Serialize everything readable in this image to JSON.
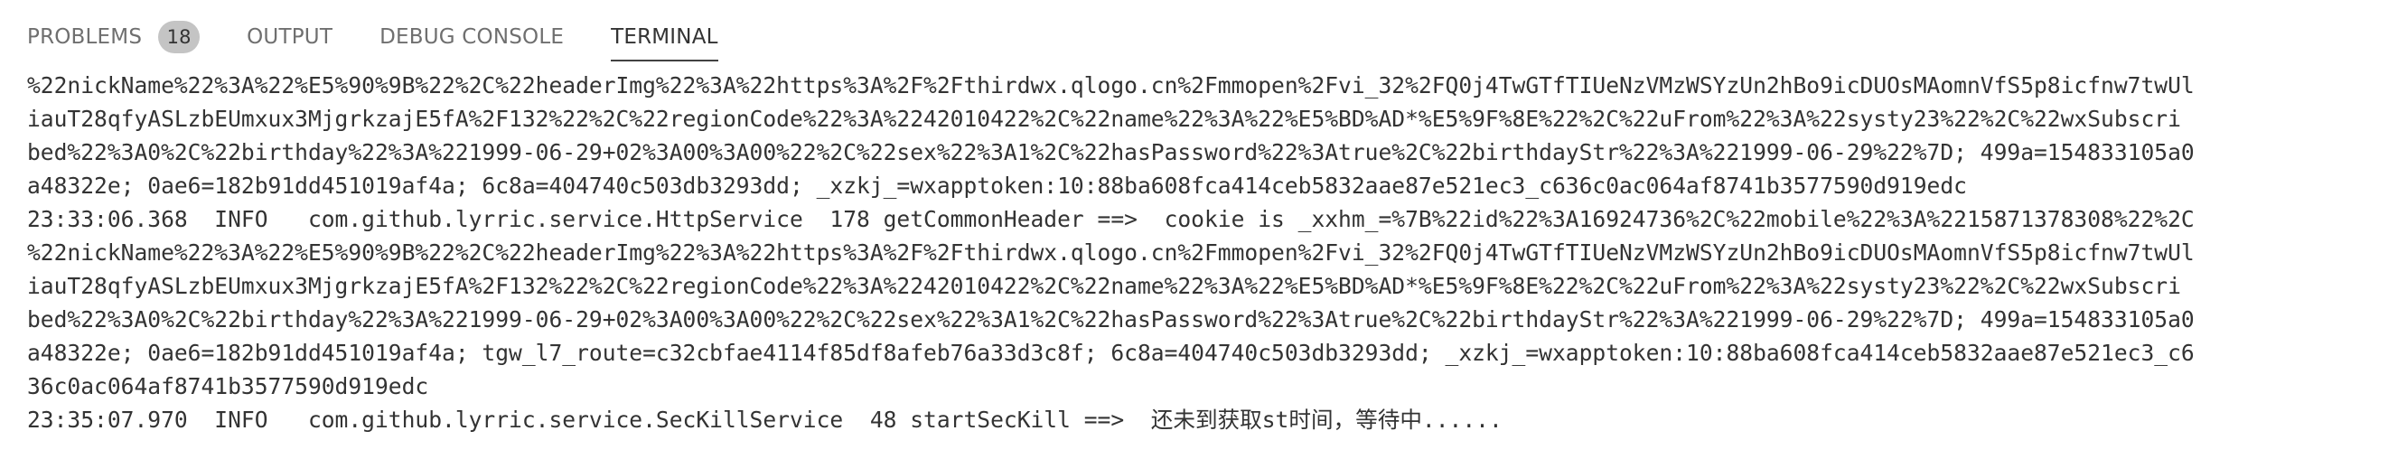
{
  "tabs": [
    {
      "label": "PROBLEMS",
      "badge": "18",
      "active": false
    },
    {
      "label": "OUTPUT",
      "active": false
    },
    {
      "label": "DEBUG CONSOLE",
      "active": false
    },
    {
      "label": "TERMINAL",
      "active": true
    }
  ],
  "terminal": {
    "lines": [
      "%22nickName%22%3A%22%E5%90%9B%22%2C%22headerImg%22%3A%22https%3A%2F%2Fthirdwx.qlogo.cn%2Fmmopen%2Fvi_32%2FQ0j4TwGTfTIUeNzVMzWSYzUn2hBo9icDUOsMAomnVfS5p8icfnw7twUl",
      "iauT28qfyASLzbEUmxux3MjgrkzajE5fA%2F132%22%2C%22regionCode%22%3A%2242010422%2C%22name%22%3A%22%E5%BD%AD*%E5%9F%8E%22%2C%22uFrom%22%3A%22systy23%22%2C%22wxSubscri",
      "bed%22%3A0%2C%22birthday%22%3A%221999-06-29+02%3A00%3A00%22%2C%22sex%22%3A1%2C%22hasPassword%22%3Atrue%2C%22birthdayStr%22%3A%221999-06-29%22%7D; 499a=154833105a0",
      "a48322e; 0ae6=182b91dd451019af4a; 6c8a=404740c503db3293dd; _xzkj_=wxapptoken:10:88ba608fca414ceb5832aae87e521ec3_c636c0ac064af8741b3577590d919edc",
      "23:33:06.368  INFO   com.github.lyrric.service.HttpService  178 getCommonHeader ==>  cookie is _xxhm_=%7B%22id%22%3A16924736%2C%22mobile%22%3A%2215871378308%22%2C",
      "%22nickName%22%3A%22%E5%90%9B%22%2C%22headerImg%22%3A%22https%3A%2F%2Fthirdwx.qlogo.cn%2Fmmopen%2Fvi_32%2FQ0j4TwGTfTIUeNzVMzWSYzUn2hBo9icDUOsMAomnVfS5p8icfnw7twUl",
      "iauT28qfyASLzbEUmxux3MjgrkzajE5fA%2F132%22%2C%22regionCode%22%3A%2242010422%2C%22name%22%3A%22%E5%BD%AD*%E5%9F%8E%22%2C%22uFrom%22%3A%22systy23%22%2C%22wxSubscri",
      "bed%22%3A0%2C%22birthday%22%3A%221999-06-29+02%3A00%3A00%22%2C%22sex%22%3A1%2C%22hasPassword%22%3Atrue%2C%22birthdayStr%22%3A%221999-06-29%22%7D; 499a=154833105a0",
      "a48322e; 0ae6=182b91dd451019af4a; tgw_l7_route=c32cbfae4114f85df8afeb76a33d3c8f; 6c8a=404740c503db3293dd; _xzkj_=wxapptoken:10:88ba608fca414ceb5832aae87e521ec3_c6",
      "36c0ac064af8741b3577590d919edc",
      "23:35:07.970  INFO   com.github.lyrric.service.SecKillService  48 startSecKill ==>  还未到获取st时间，等待中......"
    ]
  }
}
